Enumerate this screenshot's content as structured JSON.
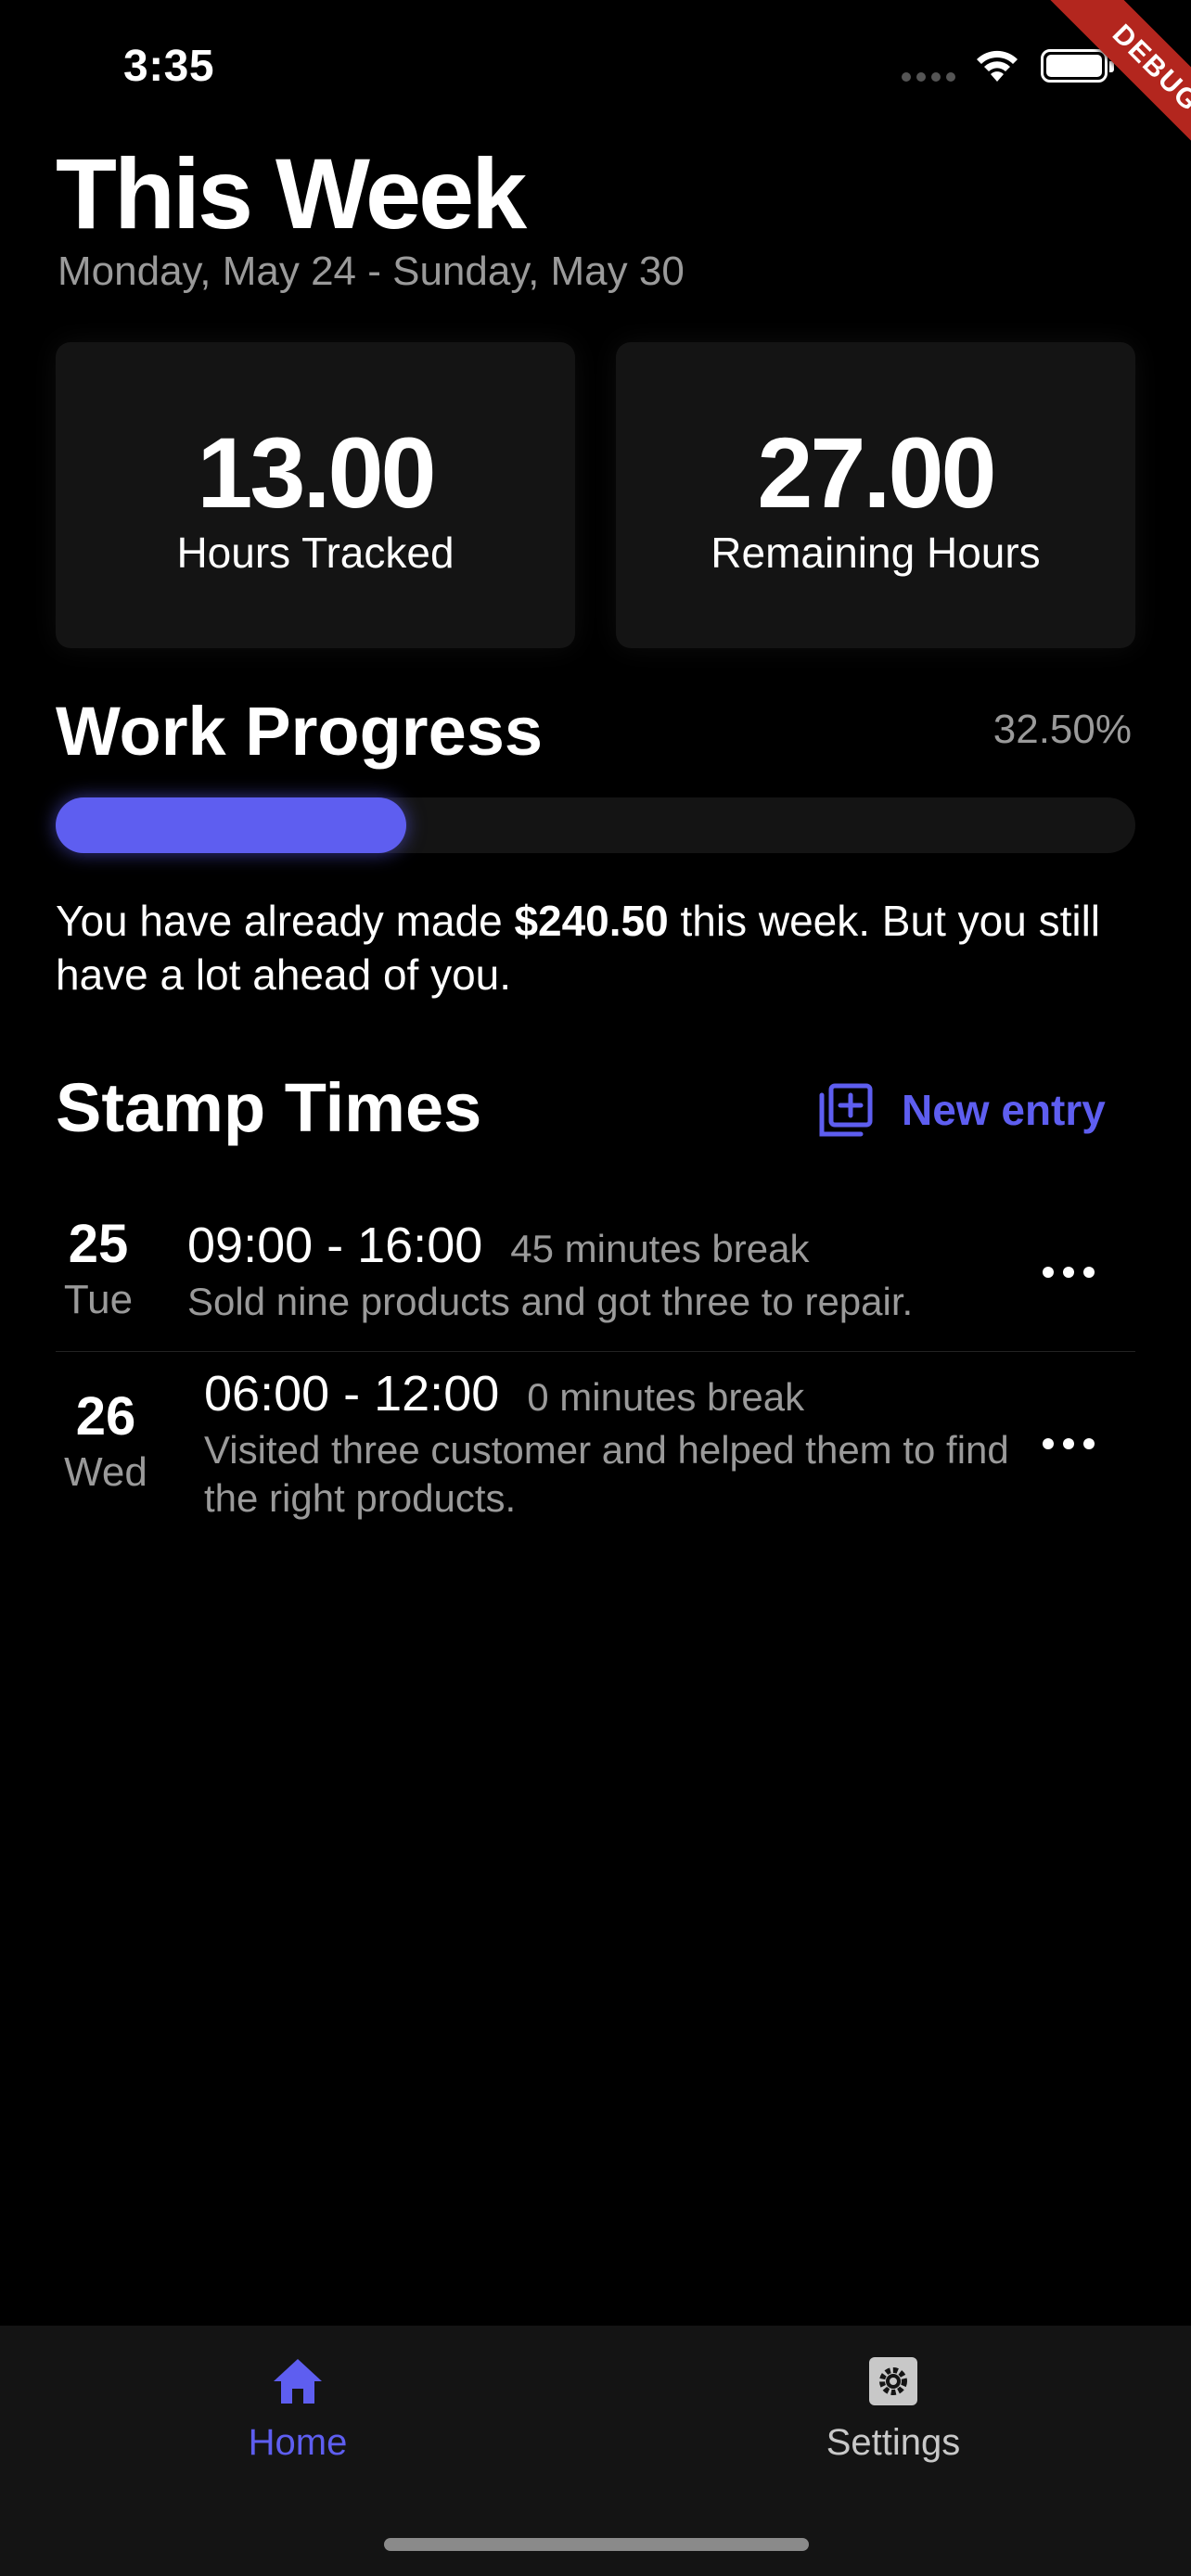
{
  "status_bar": {
    "time": "3:35"
  },
  "debug_banner": "DEBUG",
  "header": {
    "title": "This Week",
    "date_range": "Monday, May 24 - Sunday, May 30"
  },
  "stats": [
    {
      "value": "13.00",
      "label": "Hours Tracked"
    },
    {
      "value": "27.00",
      "label": "Remaining Hours"
    }
  ],
  "progress": {
    "title": "Work Progress",
    "percent_text": "32.50%",
    "fraction": 0.325,
    "text_before": "You have already made ",
    "amount": "$240.50",
    "text_after": " this week. But you still have a lot ahead of you."
  },
  "stamp_times": {
    "title": "Stamp Times",
    "new_entry_label": "New entry",
    "entries": [
      {
        "day": "25",
        "weekday": "Tue",
        "time": "09:00 - 16:00",
        "break": "45 minutes break",
        "description": "Sold nine products and got three to repair."
      },
      {
        "day": "26",
        "weekday": "Wed",
        "time": "06:00 - 12:00",
        "break": "0 minutes break",
        "description": "Visited three customer and helped them to find the right products."
      }
    ]
  },
  "bottom_nav": {
    "items": [
      {
        "label": "Home",
        "icon": "home-icon",
        "active": true
      },
      {
        "label": "Settings",
        "icon": "gear-icon",
        "active": false
      }
    ]
  },
  "colors": {
    "accent": "#5e5ef0",
    "card": "#141414",
    "muted": "#9a9a9a"
  }
}
